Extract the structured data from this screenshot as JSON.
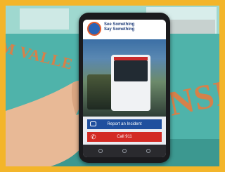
{
  "bus_lettering": {
    "left_text": "M VALLE",
    "right_text": "NSIT"
  },
  "app": {
    "title_line1": "See Something",
    "title_line2": "Say Something",
    "report_label": "Report an Incident",
    "call_label": "Call 911"
  },
  "colors": {
    "frame": "#f3b52a",
    "bus_body": "#5db8b0",
    "report_button": "#1f4f9e",
    "call_button": "#d32a24"
  },
  "icons": [
    "camera-icon",
    "phone-icon",
    "app-logo"
  ]
}
